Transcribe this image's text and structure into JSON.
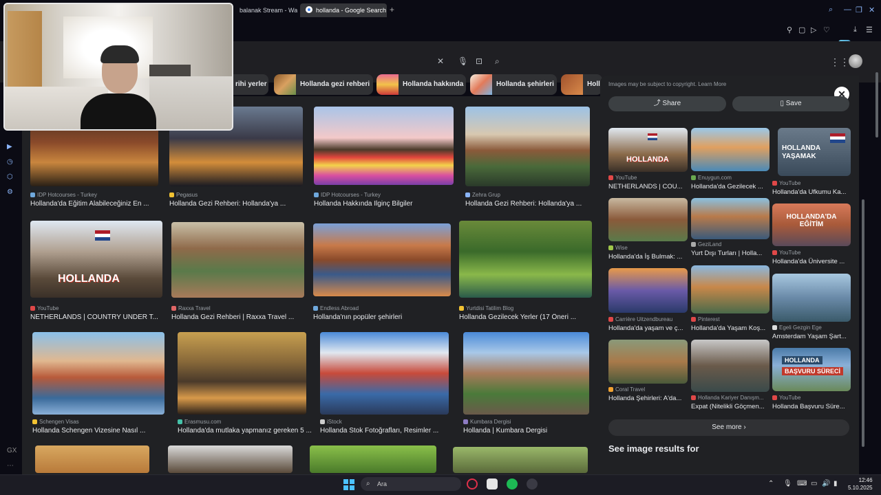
{
  "browser": {
    "tabs": [
      {
        "label": "balanak Stream - Wat"
      },
      {
        "label": "hollanda - Google Search"
      }
    ],
    "newtab_glyph": "+"
  },
  "chips": [
    {
      "label": "rihi yerler"
    },
    {
      "label": "Hollanda gezi rehberi"
    },
    {
      "label": "Hollanda hakkında"
    },
    {
      "label": "Hollanda şehirleri"
    },
    {
      "label": "Holl"
    }
  ],
  "results": [
    {
      "source": "IDP Hotcourses - Turkey",
      "title": "Hollanda'da Eğitim Alabileceğiniz En ..."
    },
    {
      "source": "Pegasus",
      "title": "Hollanda Gezi Rehberi: Hollanda'ya ..."
    },
    {
      "source": "IDP Hotcourses - Turkey",
      "title": "Hollanda Hakkında İlginç Bilgiler"
    },
    {
      "source": "Zehra Grup",
      "title": "Hollanda Gezi Rehberi: Hollanda'ya ..."
    },
    {
      "source": "YouTube",
      "title": "NETHERLANDS | COUNTRY UNDER T..."
    },
    {
      "source": "Raxxa Travel",
      "title": "Hollanda Gezi Rehberi | Raxxa Travel ..."
    },
    {
      "source": "Endless Abroad",
      "title": "Hollanda'nın popüler şehirleri"
    },
    {
      "source": "Yurtdisi Tatilim Blog",
      "title": "Hollanda Gezilecek Yerler (17 Öneri ..."
    },
    {
      "source": "Schengen Visas",
      "title": "Hollanda Schengen Vizesine Nasıl ..."
    },
    {
      "source": "Erasmusu.com",
      "title": "Hollanda'da mutlaka yapmanız gereken 5 ..."
    },
    {
      "source": "iStock",
      "title": "Hollanda Stok Fotoğrafları, Resimler ..."
    },
    {
      "source": "Kumbara Dergisi",
      "title": "Hollanda | Kumbara Dergisi"
    }
  ],
  "thumb_text": {
    "hollanda": "HOLLANDA",
    "holland": "HOLLANDA",
    "yasamak": "YAŞAMAK"
  },
  "panel": {
    "note": "Images may be subject to copyright. Learn More",
    "share": "Share",
    "save": "Save",
    "close": "✕",
    "items": [
      {
        "source": "YouTube",
        "title": "NETHERLANDS | COU..."
      },
      {
        "source": "Enuygun.com",
        "title": "Hollanda'da Gezilecek ..."
      },
      {
        "source": "YouTube",
        "title": "Hollanda'da Ufkumu Ka..."
      },
      {
        "source": "Wise",
        "title": "Hollanda'da İş Bulmak: ..."
      },
      {
        "source": "GeziLand",
        "title": "Yurt Dışı Turları | Holla..."
      },
      {
        "source": "YouTube",
        "title": "Hollanda'da Üniversite ..."
      },
      {
        "source": "Carrière Uitzendbureau",
        "title": "Hollanda'da yaşam ve ç..."
      },
      {
        "source": "Pinterest",
        "title": "Hollanda'da Yaşam Koş..."
      },
      {
        "source": "Egeli Gezgin Ege",
        "title": "Amsterdam Yaşam Şart..."
      },
      {
        "source": "Coral Travel",
        "title": "Hollanda Şehirleri: A'da..."
      },
      {
        "source": "Hollanda Kariyer Danışm...",
        "title": "Expat (Nitelikli Göçmen..."
      },
      {
        "source": "YouTube",
        "title": "Hollanda Başvuru Süre..."
      }
    ],
    "thumb_labels": {
      "egitim": "HOLLANDA'DA EĞİTİM",
      "basvuru": "BAŞVURU SÜRECİ",
      "hollanda": "HOLLANDA",
      "yasamak": "YAŞAMAK",
      "hollanda_short": "HOLLANDA"
    },
    "see_more": "See more",
    "see_image_results": "See image results for"
  },
  "taskbar": {
    "search_placeholder": "Ara",
    "time": "12:46",
    "date": "5.10.2025"
  },
  "colors": {
    "accent": "#8ab4f8",
    "panel_bg": "#202124"
  }
}
